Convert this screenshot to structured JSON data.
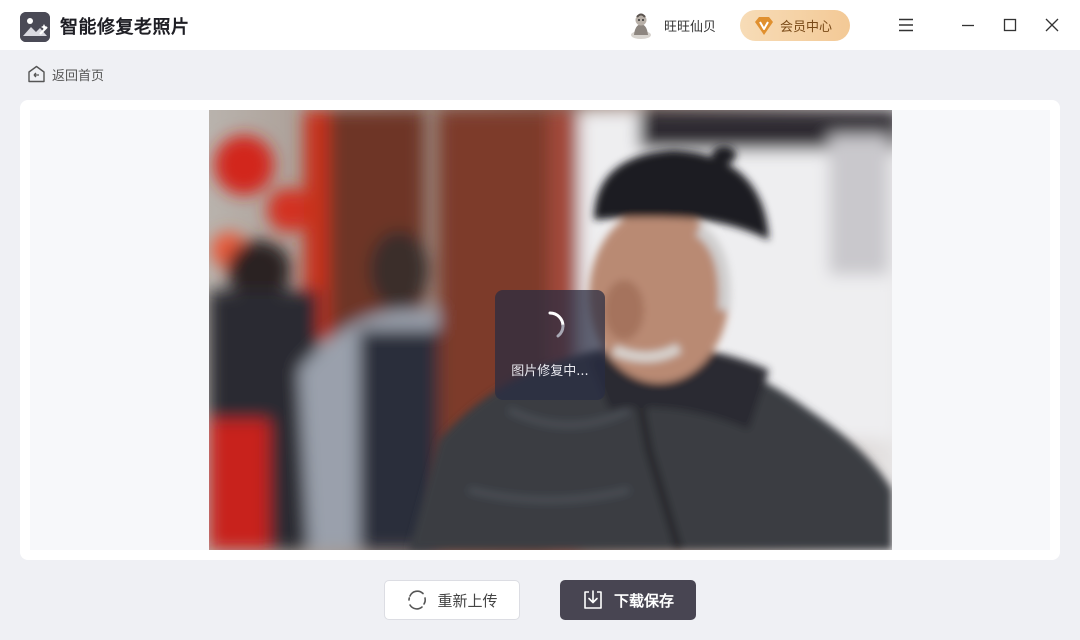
{
  "app": {
    "title": "智能修复老照片",
    "logo_icon": "photo-magic-icon"
  },
  "header": {
    "user_name": "旺旺仙贝",
    "vip_label": "会员中心",
    "vip_icon": "diamond-v-icon",
    "menu_icon": "hamburger-menu-icon",
    "minimize_icon": "minimize-icon",
    "maximize_icon": "maximize-icon",
    "close_icon": "close-icon"
  },
  "nav": {
    "back_label": "返回首页",
    "back_icon": "home-back-icon"
  },
  "preview": {
    "loading_text": "图片修复中...",
    "loading_icon": "spinner-icon"
  },
  "actions": {
    "reupload_label": "重新上传",
    "reupload_icon": "refresh-icon",
    "download_label": "下载保存",
    "download_icon": "download-icon"
  },
  "colors": {
    "accent_dark": "#484552",
    "vip_gold": "#f3c996",
    "page_bg": "#eff0f4"
  }
}
